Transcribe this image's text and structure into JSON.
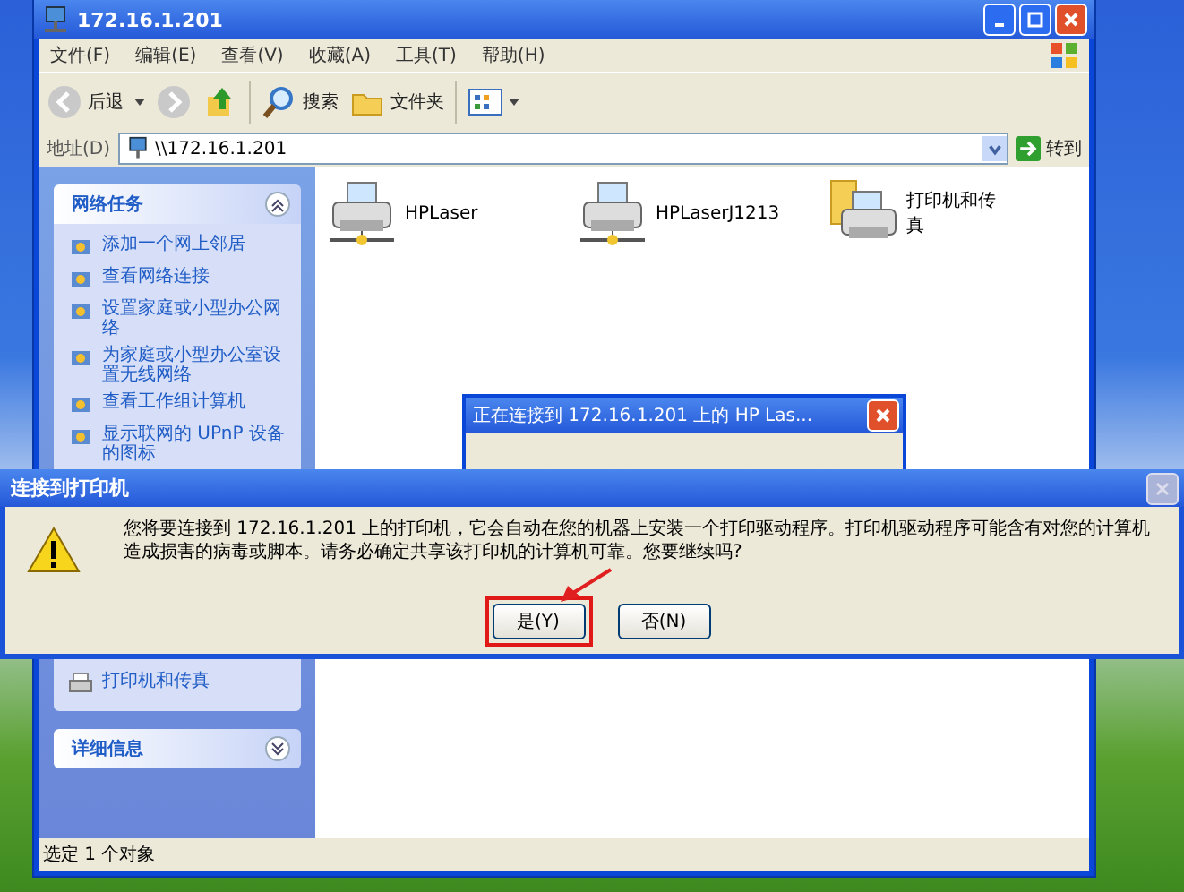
{
  "window": {
    "title": "172.16.1.201"
  },
  "menu": [
    "文件(F)",
    "编辑(E)",
    "查看(V)",
    "收藏(A)",
    "工具(T)",
    "帮助(H)"
  ],
  "toolbar": {
    "back": "后退",
    "search": "搜索",
    "folders": "文件夹"
  },
  "address": {
    "label": "地址(D)",
    "value": "\\\\172.16.1.201",
    "go": "转到"
  },
  "task_pane": {
    "title": "网络任务",
    "expanded": true,
    "items": [
      "添加一个网上邻居",
      "查看网络连接",
      "设置家庭或小型办公网络",
      "为家庭或小型办公室设置无线网络",
      "查看工作组计算机",
      "显示联网的 UPnP 设备的图标"
    ]
  },
  "other_places": {
    "items": [
      "打印机和传真"
    ]
  },
  "details": {
    "title": "详细信息",
    "expanded": false
  },
  "files": [
    {
      "name": "HPLaser",
      "kind": "shared-printer"
    },
    {
      "name": "HPLaserJ1213",
      "kind": "shared-printer"
    },
    {
      "name": "打印机和传真",
      "kind": "printers-folder"
    }
  ],
  "progress_dialog": {
    "title": "正在连接到 172.16.1.201 上的 HP Las..."
  },
  "connect_dialog": {
    "title": "连接到打印机",
    "message": "您将要连接到 172.16.1.201 上的打印机，它会自动在您的机器上安装一个打印驱动程序。打印机驱动程序可能含有对您的计算机造成损害的病毒或脚本。请务必确定共享该打印机的计算机可靠。您要继续吗?",
    "buttons": [
      {
        "label": "是(Y)",
        "annotated": true
      },
      {
        "label": "否(N)",
        "annotated": false
      }
    ]
  },
  "status_bar": "选定 1 个对象"
}
